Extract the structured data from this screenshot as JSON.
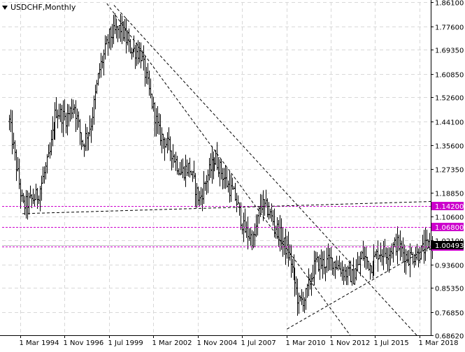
{
  "chart_data": {
    "type": "ohlc",
    "title": "USDCHF,Monthly",
    "y_axis": {
      "min": 0.6862,
      "max": 1.861,
      "ticks": [
        "1.86100",
        "1.77600",
        "1.69350",
        "1.60850",
        "1.52600",
        "1.44100",
        "1.35600",
        "1.27350",
        "1.18850",
        "1.10600",
        "1.02100",
        "0.93600",
        "0.85350",
        "0.76850",
        "0.68620"
      ],
      "tick_values": [
        1.861,
        1.776,
        1.6935,
        1.6085,
        1.526,
        1.441,
        1.356,
        1.2735,
        1.1885,
        1.106,
        1.021,
        0.936,
        0.8535,
        0.7685,
        0.6862
      ]
    },
    "x_axis": {
      "tick_labels": [
        "1 Mar 1994",
        "1 Nov 1996",
        "1 Jul 1999",
        "1 Mar 2002",
        "1 Nov 2004",
        "1 Jul 2007",
        "1 Mar 2010",
        "1 Nov 2012",
        "1 Jul 2015",
        "1 Mar 2018"
      ],
      "tick_years": [
        1994.17,
        1996.83,
        1999.5,
        2002.17,
        2004.83,
        2007.5,
        2010.17,
        2012.83,
        2015.5,
        2018.17
      ],
      "range_years": [
        1993.5,
        2019.0
      ]
    },
    "horizontal_levels": [
      {
        "label": "1.14200",
        "value": 1.142,
        "color": "#cc00cc"
      },
      {
        "label": "1.06800",
        "value": 1.068,
        "color": "#cc00cc"
      },
      {
        "label": "0.99800",
        "value": 0.998,
        "color": "#cc00cc"
      }
    ],
    "current_price": {
      "label": "1.00493",
      "value": 1.0049
    },
    "trendlines": [
      {
        "from": [
          1999.8,
          1.85
        ],
        "to": [
          2018.0,
          0.686
        ]
      },
      {
        "from": [
          1999.2,
          1.87
        ],
        "to": [
          2014.0,
          0.686
        ]
      },
      {
        "from": [
          1994.3,
          1.115
        ],
        "to": [
          2019.0,
          1.158
        ]
      },
      {
        "from": [
          2010.2,
          0.708
        ],
        "to": [
          2019.0,
          1.005
        ]
      }
    ],
    "price_path": [
      [
        1993.5,
        1.44
      ],
      [
        1994.3,
        1.14
      ],
      [
        1995.2,
        1.18
      ],
      [
        1995.9,
        1.32
      ],
      [
        1996.3,
        1.48
      ],
      [
        1996.9,
        1.45
      ],
      [
        1997.4,
        1.5
      ],
      [
        1997.9,
        1.36
      ],
      [
        1998.4,
        1.43
      ],
      [
        1998.9,
        1.62
      ],
      [
        1999.5,
        1.74
      ],
      [
        2000.2,
        1.77
      ],
      [
        2000.7,
        1.7
      ],
      [
        2001.4,
        1.68
      ],
      [
        2001.9,
        1.55
      ],
      [
        2002.5,
        1.4
      ],
      [
        2003.2,
        1.34
      ],
      [
        2003.8,
        1.26
      ],
      [
        2004.3,
        1.28
      ],
      [
        2004.9,
        1.16
      ],
      [
        2005.4,
        1.25
      ],
      [
        2005.9,
        1.31
      ],
      [
        2006.5,
        1.23
      ],
      [
        2007.1,
        1.17
      ],
      [
        2007.6,
        1.06
      ],
      [
        2008.2,
        1.02
      ],
      [
        2008.6,
        1.15
      ],
      [
        2009.0,
        1.13
      ],
      [
        2009.5,
        1.07
      ],
      [
        2009.9,
        1.02
      ],
      [
        2010.4,
        0.95
      ],
      [
        2010.9,
        0.8
      ],
      [
        2011.3,
        0.82
      ],
      [
        2011.9,
        0.94
      ],
      [
        2012.4,
        0.94
      ],
      [
        2012.9,
        0.95
      ],
      [
        2013.6,
        0.91
      ],
      [
        2014.2,
        0.89
      ],
      [
        2014.7,
        0.97
      ],
      [
        2015.2,
        0.93
      ],
      [
        2015.7,
        0.98
      ],
      [
        2016.3,
        0.98
      ],
      [
        2016.8,
        1.01
      ],
      [
        2017.4,
        0.96
      ],
      [
        2018.0,
        0.97
      ],
      [
        2018.6,
        1.0
      ],
      [
        2018.9,
        1.005
      ]
    ],
    "price_noise": 0.055,
    "grid": true,
    "colors": {
      "background": "#ffffff",
      "bars": "#000000",
      "grid": "#d8d8d8",
      "level_line": "#cc00cc",
      "level_label_bg": "#cc00cc",
      "price_label_bg": "#000000"
    }
  }
}
